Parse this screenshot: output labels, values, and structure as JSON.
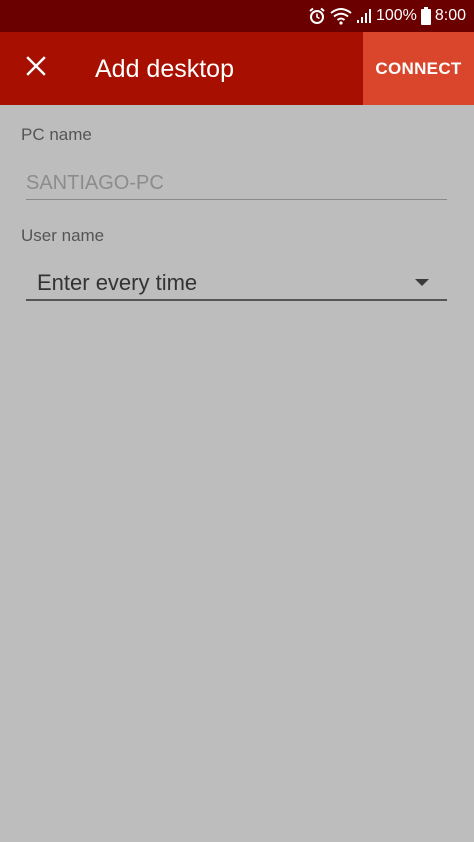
{
  "status_bar": {
    "battery_percent": "100%",
    "time": "8:00",
    "icons": [
      "alarm-icon",
      "wifi-icon",
      "signal-icon",
      "battery-icon"
    ]
  },
  "app_bar": {
    "title": "Add desktop",
    "connect_label": "CONNECT",
    "close_icon": "close-icon"
  },
  "form": {
    "pc_name_label": "PC name",
    "pc_name_placeholder": "SANTIAGO-PC",
    "pc_name_value": "",
    "user_name_label": "User name",
    "user_name_selected": "Enter every time"
  },
  "colors": {
    "status_bar": "#6b0000",
    "app_bar": "#a70f00",
    "connect_button": "#d9462b",
    "background": "#bdbdbd"
  }
}
